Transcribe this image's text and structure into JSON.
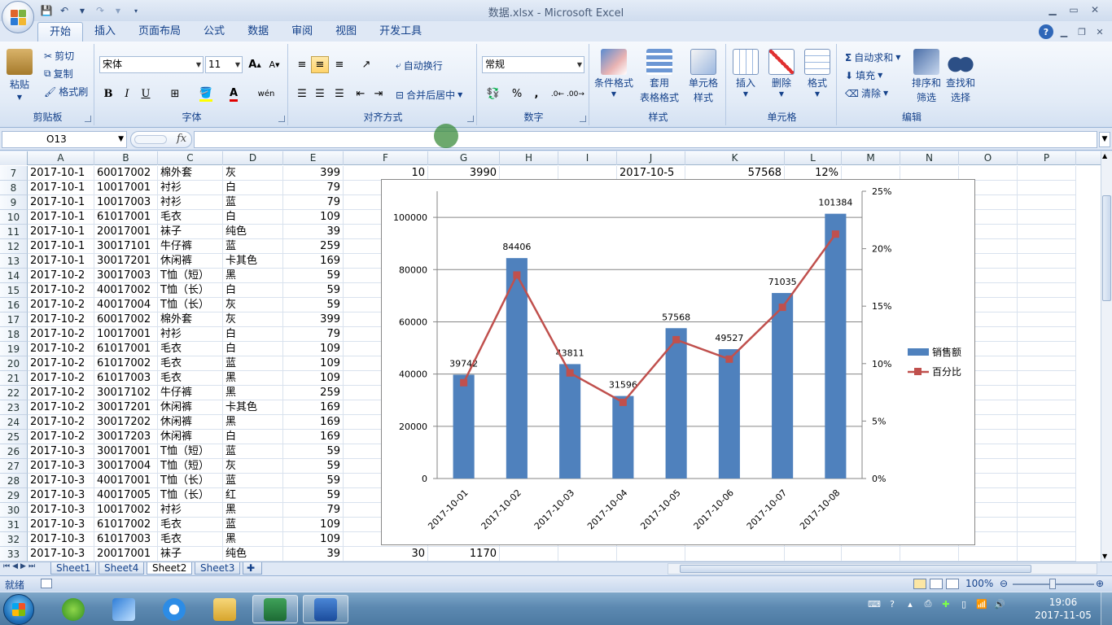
{
  "window": {
    "title": "数据.xlsx - Microsoft Excel"
  },
  "tabs": [
    "开始",
    "插入",
    "页面布局",
    "公式",
    "数据",
    "审阅",
    "视图",
    "开发工具"
  ],
  "ribbon": {
    "clipboard": {
      "label": "剪贴板",
      "paste": "粘贴",
      "cut": "剪切",
      "copy": "复制",
      "format_painter": "格式刷"
    },
    "font": {
      "label": "字体",
      "name": "宋体",
      "size": "11",
      "bold": "B",
      "italic": "I",
      "underline": "U",
      "grow": "A",
      "shrink": "A",
      "phonetic": "wén"
    },
    "alignment": {
      "label": "对齐方式",
      "wrap": "自动换行",
      "merge": "合并后居中"
    },
    "number": {
      "label": "数字",
      "format": "常规",
      "percent": "%",
      "comma": ","
    },
    "styles": {
      "label": "样式",
      "conditional": "条件格式",
      "table1": "套用",
      "table2": "表格格式",
      "cell1": "单元格",
      "cell2": "样式"
    },
    "cells": {
      "label": "单元格",
      "insert": "插入",
      "delete": "删除",
      "format": "格式"
    },
    "editing": {
      "label": "编辑",
      "autosum": "自动求和",
      "fill": "填充",
      "clear": "清除",
      "sort1": "排序和",
      "sort2": "筛选",
      "find1": "查找和",
      "find2": "选择"
    }
  },
  "formula_bar": {
    "name_box": "O13",
    "fx": "fx",
    "value": ""
  },
  "columns": [
    "A",
    "B",
    "C",
    "D",
    "E",
    "F",
    "G",
    "H",
    "I",
    "J",
    "K",
    "L",
    "M",
    "N",
    "O",
    "P"
  ],
  "rows": [
    {
      "n": "7",
      "A": "2017-10-1",
      "B": "60017002",
      "C": "棉外套",
      "D": "灰",
      "E": "399",
      "F": "10",
      "G": "3990",
      "J": "2017-10-5",
      "K": "57568",
      "L": "12%"
    },
    {
      "n": "8",
      "A": "2017-10-1",
      "B": "10017001",
      "C": "衬衫",
      "D": "白",
      "E": "79"
    },
    {
      "n": "9",
      "A": "2017-10-1",
      "B": "10017003",
      "C": "衬衫",
      "D": "蓝",
      "E": "79"
    },
    {
      "n": "10",
      "A": "2017-10-1",
      "B": "61017001",
      "C": "毛衣",
      "D": "白",
      "E": "109"
    },
    {
      "n": "11",
      "A": "2017-10-1",
      "B": "20017001",
      "C": "袜子",
      "D": "纯色",
      "E": "39"
    },
    {
      "n": "12",
      "A": "2017-10-1",
      "B": "30017101",
      "C": "牛仔裤",
      "D": "蓝",
      "E": "259"
    },
    {
      "n": "13",
      "A": "2017-10-1",
      "B": "30017201",
      "C": "休闲裤",
      "D": "卡其色",
      "E": "169"
    },
    {
      "n": "14",
      "A": "2017-10-2",
      "B": "30017003",
      "C": "T恤（短）",
      "D": "黑",
      "E": "59"
    },
    {
      "n": "15",
      "A": "2017-10-2",
      "B": "40017002",
      "C": "T恤（长）",
      "D": "白",
      "E": "59"
    },
    {
      "n": "16",
      "A": "2017-10-2",
      "B": "40017004",
      "C": "T恤（长）",
      "D": "灰",
      "E": "59"
    },
    {
      "n": "17",
      "A": "2017-10-2",
      "B": "60017002",
      "C": "棉外套",
      "D": "灰",
      "E": "399"
    },
    {
      "n": "18",
      "A": "2017-10-2",
      "B": "10017001",
      "C": "衬衫",
      "D": "白",
      "E": "79"
    },
    {
      "n": "19",
      "A": "2017-10-2",
      "B": "61017001",
      "C": "毛衣",
      "D": "白",
      "E": "109"
    },
    {
      "n": "20",
      "A": "2017-10-2",
      "B": "61017002",
      "C": "毛衣",
      "D": "蓝",
      "E": "109"
    },
    {
      "n": "21",
      "A": "2017-10-2",
      "B": "61017003",
      "C": "毛衣",
      "D": "黑",
      "E": "109"
    },
    {
      "n": "22",
      "A": "2017-10-2",
      "B": "30017102",
      "C": "牛仔裤",
      "D": "黑",
      "E": "259"
    },
    {
      "n": "23",
      "A": "2017-10-2",
      "B": "30017201",
      "C": "休闲裤",
      "D": "卡其色",
      "E": "169"
    },
    {
      "n": "24",
      "A": "2017-10-2",
      "B": "30017202",
      "C": "休闲裤",
      "D": "黑",
      "E": "169"
    },
    {
      "n": "25",
      "A": "2017-10-2",
      "B": "30017203",
      "C": "休闲裤",
      "D": "白",
      "E": "169"
    },
    {
      "n": "26",
      "A": "2017-10-3",
      "B": "30017001",
      "C": "T恤（短）",
      "D": "蓝",
      "E": "59"
    },
    {
      "n": "27",
      "A": "2017-10-3",
      "B": "30017004",
      "C": "T恤（短）",
      "D": "灰",
      "E": "59"
    },
    {
      "n": "28",
      "A": "2017-10-3",
      "B": "40017001",
      "C": "T恤（长）",
      "D": "蓝",
      "E": "59"
    },
    {
      "n": "29",
      "A": "2017-10-3",
      "B": "40017005",
      "C": "T恤（长）",
      "D": "红",
      "E": "59"
    },
    {
      "n": "30",
      "A": "2017-10-3",
      "B": "10017002",
      "C": "衬衫",
      "D": "黑",
      "E": "79"
    },
    {
      "n": "31",
      "A": "2017-10-3",
      "B": "61017002",
      "C": "毛衣",
      "D": "蓝",
      "E": "109"
    },
    {
      "n": "32",
      "A": "2017-10-3",
      "B": "61017003",
      "C": "毛衣",
      "D": "黑",
      "E": "109"
    },
    {
      "n": "33",
      "A": "2017-10-3",
      "B": "20017001",
      "C": "袜子",
      "D": "纯色",
      "E": "39",
      "F": "30",
      "G": "1170"
    }
  ],
  "sheets": [
    "Sheet1",
    "Sheet4",
    "Sheet2",
    "Sheet3"
  ],
  "active_sheet": "Sheet2",
  "status": {
    "ready": "就绪",
    "zoom": "100%"
  },
  "clock": {
    "time": "19:06",
    "date": "2017-11-05"
  },
  "chart_data": {
    "type": "bar",
    "categories": [
      "2017-10-01",
      "2017-10-02",
      "2017-10-03",
      "2017-10-04",
      "2017-10-05",
      "2017-10-06",
      "2017-10-07",
      "2017-10-08"
    ],
    "series": [
      {
        "name": "销售额",
        "type": "bar",
        "axis": "left",
        "color": "#4f81bd",
        "values": [
          39742,
          84406,
          43811,
          31596,
          57568,
          49527,
          71035,
          101384
        ]
      },
      {
        "name": "百分比",
        "type": "line",
        "axis": "right",
        "color": "#c0504d",
        "values": [
          0.0834,
          0.1771,
          0.0919,
          0.0663,
          0.1208,
          0.1039,
          0.149,
          0.2127
        ]
      }
    ],
    "y_left": {
      "min": 0,
      "max": 110000,
      "ticks": [
        "0",
        "20000",
        "40000",
        "60000",
        "80000",
        "100000"
      ]
    },
    "y_right": {
      "min": 0,
      "max": 0.25,
      "ticks": [
        "0%",
        "5%",
        "10%",
        "15%",
        "20%",
        "25%"
      ]
    },
    "data_labels": [
      "39742",
      "84406",
      "43811",
      "31596",
      "57568",
      "49527",
      "71035",
      "101384"
    ],
    "legend": "right",
    "grid": true
  }
}
